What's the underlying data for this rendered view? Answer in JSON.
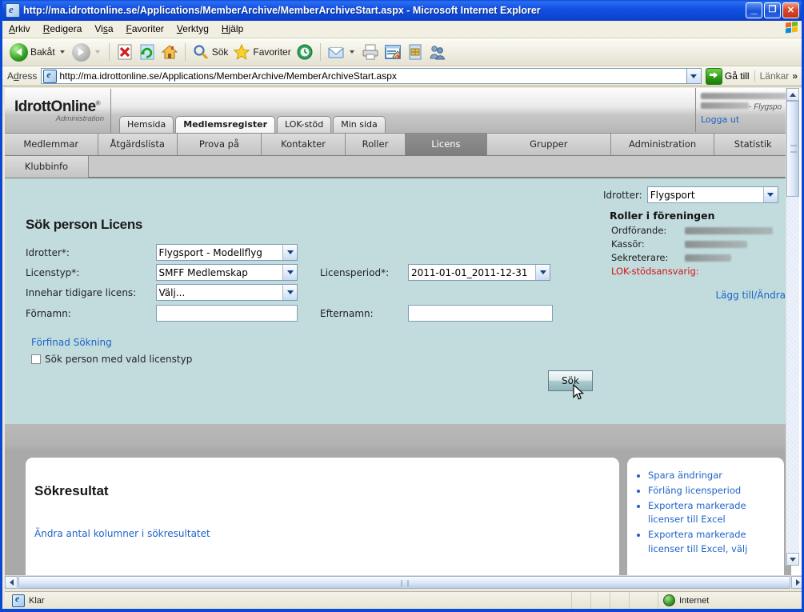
{
  "browser": {
    "title": "http://ma.idrottonline.se/Applications/MemberArchive/MemberArchiveStart.aspx - Microsoft Internet Explorer",
    "window_buttons": {
      "minimize": "_",
      "maximize": "❐",
      "close": "✕"
    },
    "menu": [
      "Arkiv",
      "Redigera",
      "Visa",
      "Favoriter",
      "Verktyg",
      "Hjälp"
    ],
    "toolbar": {
      "back_label": "Bakåt",
      "search_label": "Sök",
      "favorites_label": "Favoriter"
    },
    "address": {
      "label": "Adress",
      "url": "http://ma.idrottonline.se/Applications/MemberArchive/MemberArchiveStart.aspx",
      "go_label": "Gå till",
      "links_label": "Länkar",
      "chevron": "»"
    },
    "status": {
      "text": "Klar",
      "zone": "Internet"
    }
  },
  "site": {
    "logo_name": "IdrottOnline",
    "logo_reg": "®",
    "logo_sub": "Administration",
    "app_tabs": [
      {
        "label": "Hemsida",
        "active": false
      },
      {
        "label": "Medlemsregister",
        "active": true
      },
      {
        "label": "LOK-stöd",
        "active": false
      },
      {
        "label": "Min sida",
        "active": false
      }
    ],
    "user": {
      "name_redacted": true,
      "org_suffix": "- Flygspo",
      "logout_label": "Logga ut"
    },
    "nav_row1": [
      {
        "label": "Medlemmar",
        "active": false
      },
      {
        "label": "Åtgärdslista",
        "active": false
      },
      {
        "label": "Prova på",
        "active": false
      },
      {
        "label": "Kontakter",
        "active": false
      },
      {
        "label": "Roller",
        "active": false
      },
      {
        "label": "Licens",
        "active": true
      },
      {
        "label": "Grupper",
        "active": false
      },
      {
        "label": "Administration",
        "active": false
      },
      {
        "label": "Statistik",
        "active": false
      }
    ],
    "nav_row2": [
      {
        "label": "Klubbinfo",
        "active": false
      }
    ]
  },
  "form": {
    "heading": "Sök person Licens",
    "fields": {
      "idrotter_label": "Idrotter*:",
      "idrotter_value": "Flygsport - Modellflyg",
      "licenstyp_label": "Licenstyp*:",
      "licenstyp_value": "SMFF Medlemskap",
      "tidigare_label": "Innehar tidigare licens:",
      "tidigare_value": "Välj...",
      "fornamn_label": "Förnamn:",
      "fornamn_value": "",
      "fornamn_placeholder": "",
      "licensperiod_label": "Licensperiod*:",
      "licensperiod_value": "2011-01-01_2011-12-31",
      "efternamn_label": "Efternamn:",
      "efternamn_value": "",
      "efternamn_placeholder": ""
    },
    "refine_link": "Förfinad Sökning",
    "checkbox_label": "Sök person med vald licenstyp",
    "checkbox_checked": false,
    "search_button": "Sök"
  },
  "sidebar": {
    "idrotter_label": "Idrotter:",
    "idrotter_value": "Flygsport",
    "roles_title": "Roller i föreningen",
    "roles": [
      {
        "label": "Ordförande:",
        "value": "",
        "redacted": true,
        "highlight": false
      },
      {
        "label": "Kassör:",
        "value": "",
        "redacted": true,
        "highlight": false
      },
      {
        "label": "Sekreterare:",
        "value": "",
        "redacted": true,
        "highlight": false
      },
      {
        "label": "LOK-stödsansvarig:",
        "value": "",
        "redacted": false,
        "highlight": true
      }
    ],
    "edit_link": "Lägg till/Ändra"
  },
  "results": {
    "title": "Sökresultat",
    "columns_link": "Ändra antal kolumner i sökresultatet",
    "actions": [
      "Spara ändringar",
      "Förläng licensperiod",
      "Exportera markerade licenser till Excel",
      "Exportera markerade licenser till Excel, välj"
    ]
  },
  "colors": {
    "titlebar_blue": "#0b4ad8",
    "form_background": "#c2dcde",
    "tab_active": "#8f8f8f",
    "link_blue": "#1d63c8",
    "alert_red": "#d01414"
  }
}
